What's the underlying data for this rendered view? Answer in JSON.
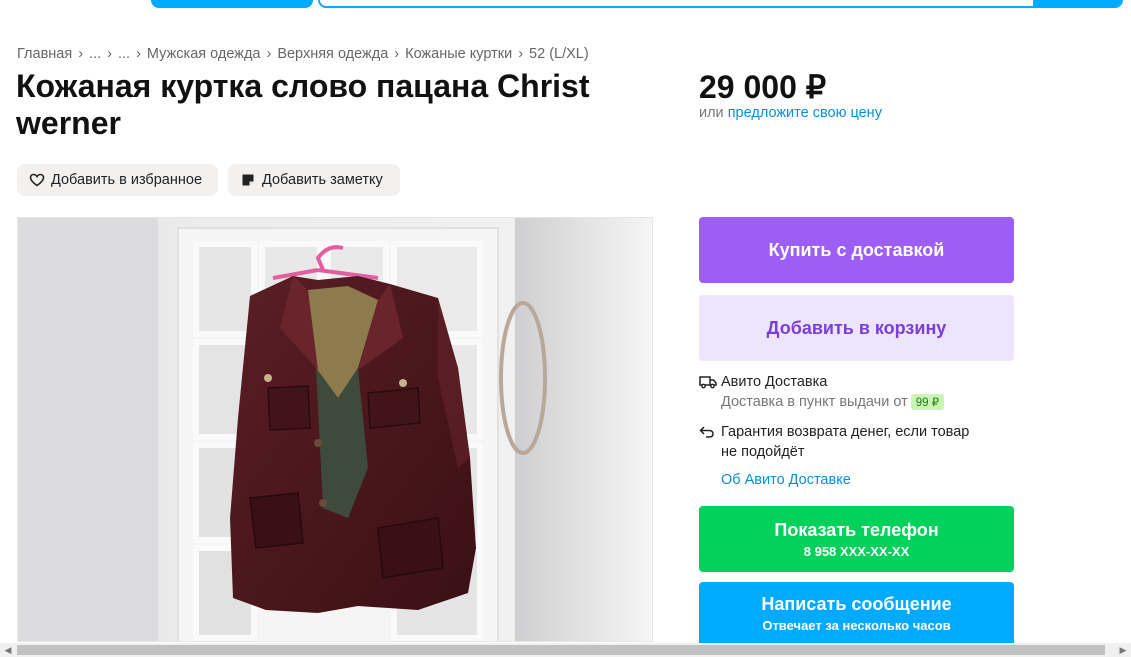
{
  "breadcrumb": [
    "Главная",
    "...",
    "...",
    "Мужская одежда",
    "Верхняя одежда",
    "Кожаные куртки",
    "52 (L/XL)"
  ],
  "breadcrumb_sep": "›",
  "listing": {
    "title": "Кожаная куртка слово пацана Christ werner",
    "price": "29 000 ₽",
    "price_or": "или",
    "price_offer_link": "предложите свою цену"
  },
  "actions": {
    "favorite": "Добавить в избранное",
    "note": "Добавить заметку"
  },
  "buy": {
    "delivery_button": "Купить с доставкой",
    "cart_button": "Добавить в корзину"
  },
  "delivery": {
    "title": "Авито Доставка",
    "pickup_text": "Доставка в пункт выдачи от",
    "pickup_price": "99 ₽",
    "guarantee_line1": "Гарантия возврата денег, если товар",
    "guarantee_line2": "не подойдёт",
    "about_link": "Об Авито Доставке"
  },
  "contact": {
    "phone_button": "Показать телефон",
    "phone_masked": "8 958 XXX-XX-XX",
    "message_button": "Написать сообщение",
    "message_sub": "Отвечает за несколько часов"
  },
  "colors": {
    "accent_blue": "#00aaff",
    "buy_purple": "#9c5ef5",
    "cart_lavender": "#ede4fd",
    "phone_green": "#02d15c",
    "message_blue": "#00aaff"
  }
}
